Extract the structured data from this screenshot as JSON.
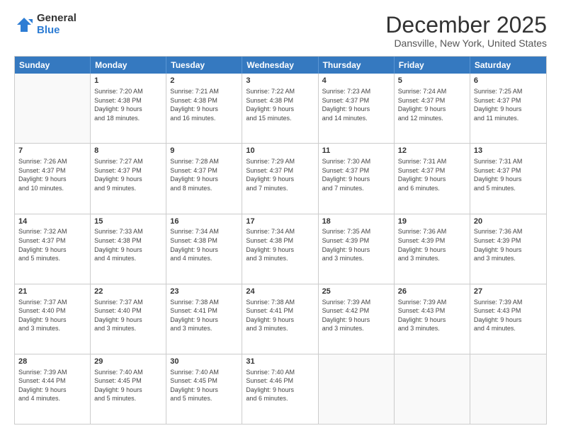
{
  "logo": {
    "general": "General",
    "blue": "Blue"
  },
  "title": "December 2025",
  "subtitle": "Dansville, New York, United States",
  "headers": [
    "Sunday",
    "Monday",
    "Tuesday",
    "Wednesday",
    "Thursday",
    "Friday",
    "Saturday"
  ],
  "rows": [
    [
      {
        "day": "",
        "text": ""
      },
      {
        "day": "1",
        "text": "Sunrise: 7:20 AM\nSunset: 4:38 PM\nDaylight: 9 hours\nand 18 minutes."
      },
      {
        "day": "2",
        "text": "Sunrise: 7:21 AM\nSunset: 4:38 PM\nDaylight: 9 hours\nand 16 minutes."
      },
      {
        "day": "3",
        "text": "Sunrise: 7:22 AM\nSunset: 4:38 PM\nDaylight: 9 hours\nand 15 minutes."
      },
      {
        "day": "4",
        "text": "Sunrise: 7:23 AM\nSunset: 4:37 PM\nDaylight: 9 hours\nand 14 minutes."
      },
      {
        "day": "5",
        "text": "Sunrise: 7:24 AM\nSunset: 4:37 PM\nDaylight: 9 hours\nand 12 minutes."
      },
      {
        "day": "6",
        "text": "Sunrise: 7:25 AM\nSunset: 4:37 PM\nDaylight: 9 hours\nand 11 minutes."
      }
    ],
    [
      {
        "day": "7",
        "text": "Sunrise: 7:26 AM\nSunset: 4:37 PM\nDaylight: 9 hours\nand 10 minutes."
      },
      {
        "day": "8",
        "text": "Sunrise: 7:27 AM\nSunset: 4:37 PM\nDaylight: 9 hours\nand 9 minutes."
      },
      {
        "day": "9",
        "text": "Sunrise: 7:28 AM\nSunset: 4:37 PM\nDaylight: 9 hours\nand 8 minutes."
      },
      {
        "day": "10",
        "text": "Sunrise: 7:29 AM\nSunset: 4:37 PM\nDaylight: 9 hours\nand 7 minutes."
      },
      {
        "day": "11",
        "text": "Sunrise: 7:30 AM\nSunset: 4:37 PM\nDaylight: 9 hours\nand 7 minutes."
      },
      {
        "day": "12",
        "text": "Sunrise: 7:31 AM\nSunset: 4:37 PM\nDaylight: 9 hours\nand 6 minutes."
      },
      {
        "day": "13",
        "text": "Sunrise: 7:31 AM\nSunset: 4:37 PM\nDaylight: 9 hours\nand 5 minutes."
      }
    ],
    [
      {
        "day": "14",
        "text": "Sunrise: 7:32 AM\nSunset: 4:37 PM\nDaylight: 9 hours\nand 5 minutes."
      },
      {
        "day": "15",
        "text": "Sunrise: 7:33 AM\nSunset: 4:38 PM\nDaylight: 9 hours\nand 4 minutes."
      },
      {
        "day": "16",
        "text": "Sunrise: 7:34 AM\nSunset: 4:38 PM\nDaylight: 9 hours\nand 4 minutes."
      },
      {
        "day": "17",
        "text": "Sunrise: 7:34 AM\nSunset: 4:38 PM\nDaylight: 9 hours\nand 3 minutes."
      },
      {
        "day": "18",
        "text": "Sunrise: 7:35 AM\nSunset: 4:39 PM\nDaylight: 9 hours\nand 3 minutes."
      },
      {
        "day": "19",
        "text": "Sunrise: 7:36 AM\nSunset: 4:39 PM\nDaylight: 9 hours\nand 3 minutes."
      },
      {
        "day": "20",
        "text": "Sunrise: 7:36 AM\nSunset: 4:39 PM\nDaylight: 9 hours\nand 3 minutes."
      }
    ],
    [
      {
        "day": "21",
        "text": "Sunrise: 7:37 AM\nSunset: 4:40 PM\nDaylight: 9 hours\nand 3 minutes."
      },
      {
        "day": "22",
        "text": "Sunrise: 7:37 AM\nSunset: 4:40 PM\nDaylight: 9 hours\nand 3 minutes."
      },
      {
        "day": "23",
        "text": "Sunrise: 7:38 AM\nSunset: 4:41 PM\nDaylight: 9 hours\nand 3 minutes."
      },
      {
        "day": "24",
        "text": "Sunrise: 7:38 AM\nSunset: 4:41 PM\nDaylight: 9 hours\nand 3 minutes."
      },
      {
        "day": "25",
        "text": "Sunrise: 7:39 AM\nSunset: 4:42 PM\nDaylight: 9 hours\nand 3 minutes."
      },
      {
        "day": "26",
        "text": "Sunrise: 7:39 AM\nSunset: 4:43 PM\nDaylight: 9 hours\nand 3 minutes."
      },
      {
        "day": "27",
        "text": "Sunrise: 7:39 AM\nSunset: 4:43 PM\nDaylight: 9 hours\nand 4 minutes."
      }
    ],
    [
      {
        "day": "28",
        "text": "Sunrise: 7:39 AM\nSunset: 4:44 PM\nDaylight: 9 hours\nand 4 minutes."
      },
      {
        "day": "29",
        "text": "Sunrise: 7:40 AM\nSunset: 4:45 PM\nDaylight: 9 hours\nand 5 minutes."
      },
      {
        "day": "30",
        "text": "Sunrise: 7:40 AM\nSunset: 4:45 PM\nDaylight: 9 hours\nand 5 minutes."
      },
      {
        "day": "31",
        "text": "Sunrise: 7:40 AM\nSunset: 4:46 PM\nDaylight: 9 hours\nand 6 minutes."
      },
      {
        "day": "",
        "text": ""
      },
      {
        "day": "",
        "text": ""
      },
      {
        "day": "",
        "text": ""
      }
    ]
  ]
}
